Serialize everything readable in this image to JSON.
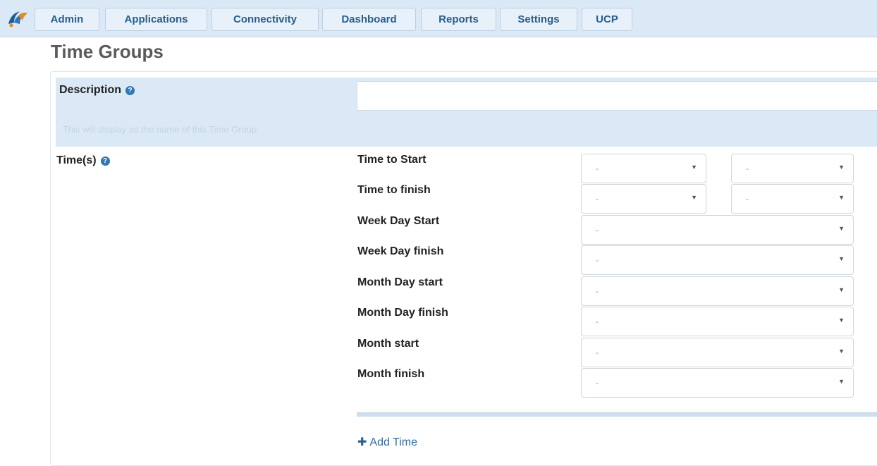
{
  "nav": {
    "logo": "freepbx-logo-icon",
    "items": [
      "Admin",
      "Applications",
      "Connectivity",
      "Dashboard",
      "Reports",
      "Settings",
      "UCP"
    ]
  },
  "page": {
    "title": "Time Groups"
  },
  "form": {
    "description": {
      "label": "Description",
      "value": "",
      "hint": "This will display as the name of this Time Group"
    },
    "times": {
      "label": "Time(s)",
      "rows": [
        {
          "label": "Time to Start",
          "selects": [
            "-",
            "-"
          ]
        },
        {
          "label": "Time to finish",
          "selects": [
            "-",
            "-"
          ]
        },
        {
          "label": "Week Day Start",
          "selects": [
            "-"
          ]
        },
        {
          "label": "Week Day finish",
          "selects": [
            "-"
          ]
        },
        {
          "label": "Month Day start",
          "selects": [
            "-"
          ]
        },
        {
          "label": "Month Day finish",
          "selects": [
            "-"
          ]
        },
        {
          "label": "Month start",
          "selects": [
            "-"
          ]
        },
        {
          "label": "Month finish",
          "selects": [
            "-"
          ]
        }
      ],
      "add_label": "Add Time"
    }
  },
  "colors": {
    "nav_bg": "#dbe9f6",
    "nav_text": "#2a5e8c",
    "accent": "#2f77b5"
  }
}
